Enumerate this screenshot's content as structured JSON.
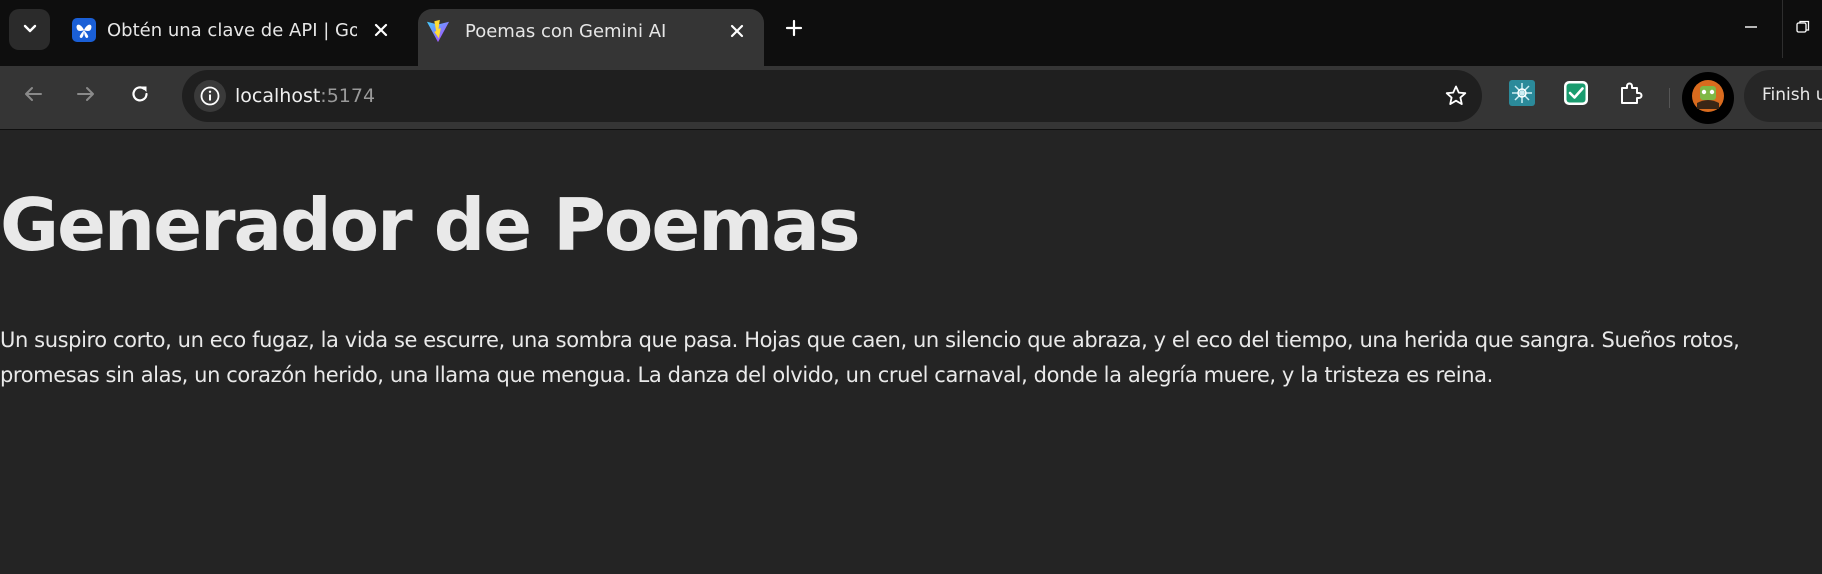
{
  "browser": {
    "tabs": [
      {
        "title": "Obtén una clave de API | Google",
        "favicon": "butterfly-icon",
        "active": false
      },
      {
        "title": "Poemas con Gemini AI",
        "favicon": "vite-icon",
        "active": true
      }
    ],
    "address_bar": {
      "host": "localhost",
      "port": ":5174"
    },
    "profile_button_label": "Finish u"
  },
  "page": {
    "heading": "Generador de Poemas",
    "poem": "Un suspiro corto, un eco fugaz, la vida se escurre, una sombra que pasa. Hojas que caen, un silencio que abraza, y el eco del tiempo, una herida que sangra. Sueños rotos, promesas sin alas, un corazón herido, una llama que mengua. La danza del olvido, un cruel carnaval, donde la alegría muere, y la tristeza es reina."
  }
}
